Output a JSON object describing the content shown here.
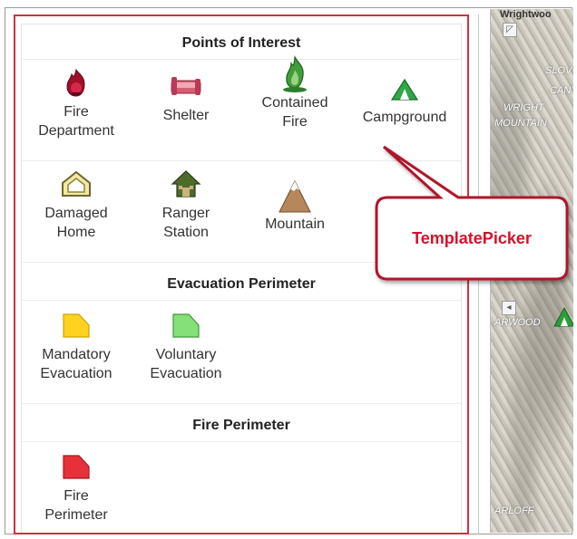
{
  "poi": {
    "title": "Points of Interest",
    "items": [
      {
        "label": "Fire\nDepartment",
        "icon": "fire-department-icon"
      },
      {
        "label": "Shelter",
        "icon": "shelter-icon"
      },
      {
        "label": "Contained\nFire",
        "icon": "contained-fire-icon"
      },
      {
        "label": "Campground",
        "icon": "campground-icon"
      },
      {
        "label": "Damaged\nHome",
        "icon": "damaged-home-icon"
      },
      {
        "label": "Ranger\nStation",
        "icon": "ranger-station-icon"
      },
      {
        "label": "Mountain",
        "icon": "mountain-icon"
      }
    ]
  },
  "evac": {
    "title": "Evacuation Perimeter",
    "items": [
      {
        "label": "Mandatory\nEvacuation",
        "icon": "mandatory-evacuation-icon",
        "color": "#ffd21f"
      },
      {
        "label": "Voluntary\nEvacuation",
        "icon": "voluntary-evacuation-icon",
        "color": "#86e07a"
      }
    ]
  },
  "fire": {
    "title": "Fire Perimeter",
    "items": [
      {
        "label": "Fire\nPerimeter",
        "icon": "fire-perimeter-icon",
        "color": "#e8303a"
      }
    ]
  },
  "callout": {
    "label": "TemplatePicker",
    "color": "#d4122a"
  },
  "map": {
    "labels": [
      "Wrightwoo",
      "SLOV",
      "CANY",
      "WRIGHT",
      "MOUNTAIN",
      "ARLOFF",
      "ARWOOD"
    ]
  }
}
